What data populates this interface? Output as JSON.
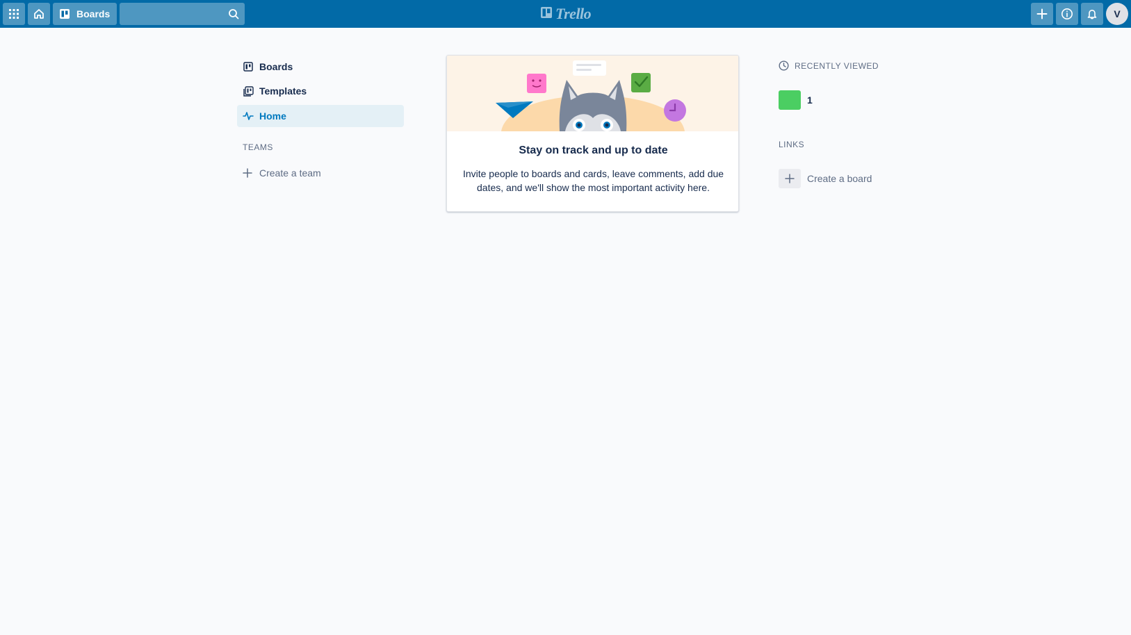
{
  "header": {
    "boards_label": "Boards",
    "search": {
      "value": "",
      "placeholder": ""
    },
    "logo_text": "Trello",
    "avatar_initial": "V",
    "icons": [
      "apps-grid-icon",
      "home-icon",
      "board-icon",
      "search-icon",
      "plus-icon",
      "info-icon",
      "bell-icon"
    ],
    "bar_color": "#026aa7"
  },
  "sidebar": {
    "items": [
      {
        "label": "Boards",
        "icon": "board-icon",
        "active": false
      },
      {
        "label": "Templates",
        "icon": "templates-icon",
        "active": false
      },
      {
        "label": "Home",
        "icon": "activity-icon",
        "active": true
      }
    ],
    "teams_heading": "TEAMS",
    "create_team_label": "Create a team"
  },
  "card": {
    "title": "Stay on track and up to date",
    "description": "Invite people to boards and cards, leave comments, add due dates, and we'll show the most important activity here."
  },
  "recently_viewed": {
    "heading": "RECENTLY VIEWED",
    "boards": [
      {
        "name": "1",
        "color": "#4bce62"
      }
    ]
  },
  "links": {
    "heading": "LINKS",
    "create_board_label": "Create a board"
  }
}
